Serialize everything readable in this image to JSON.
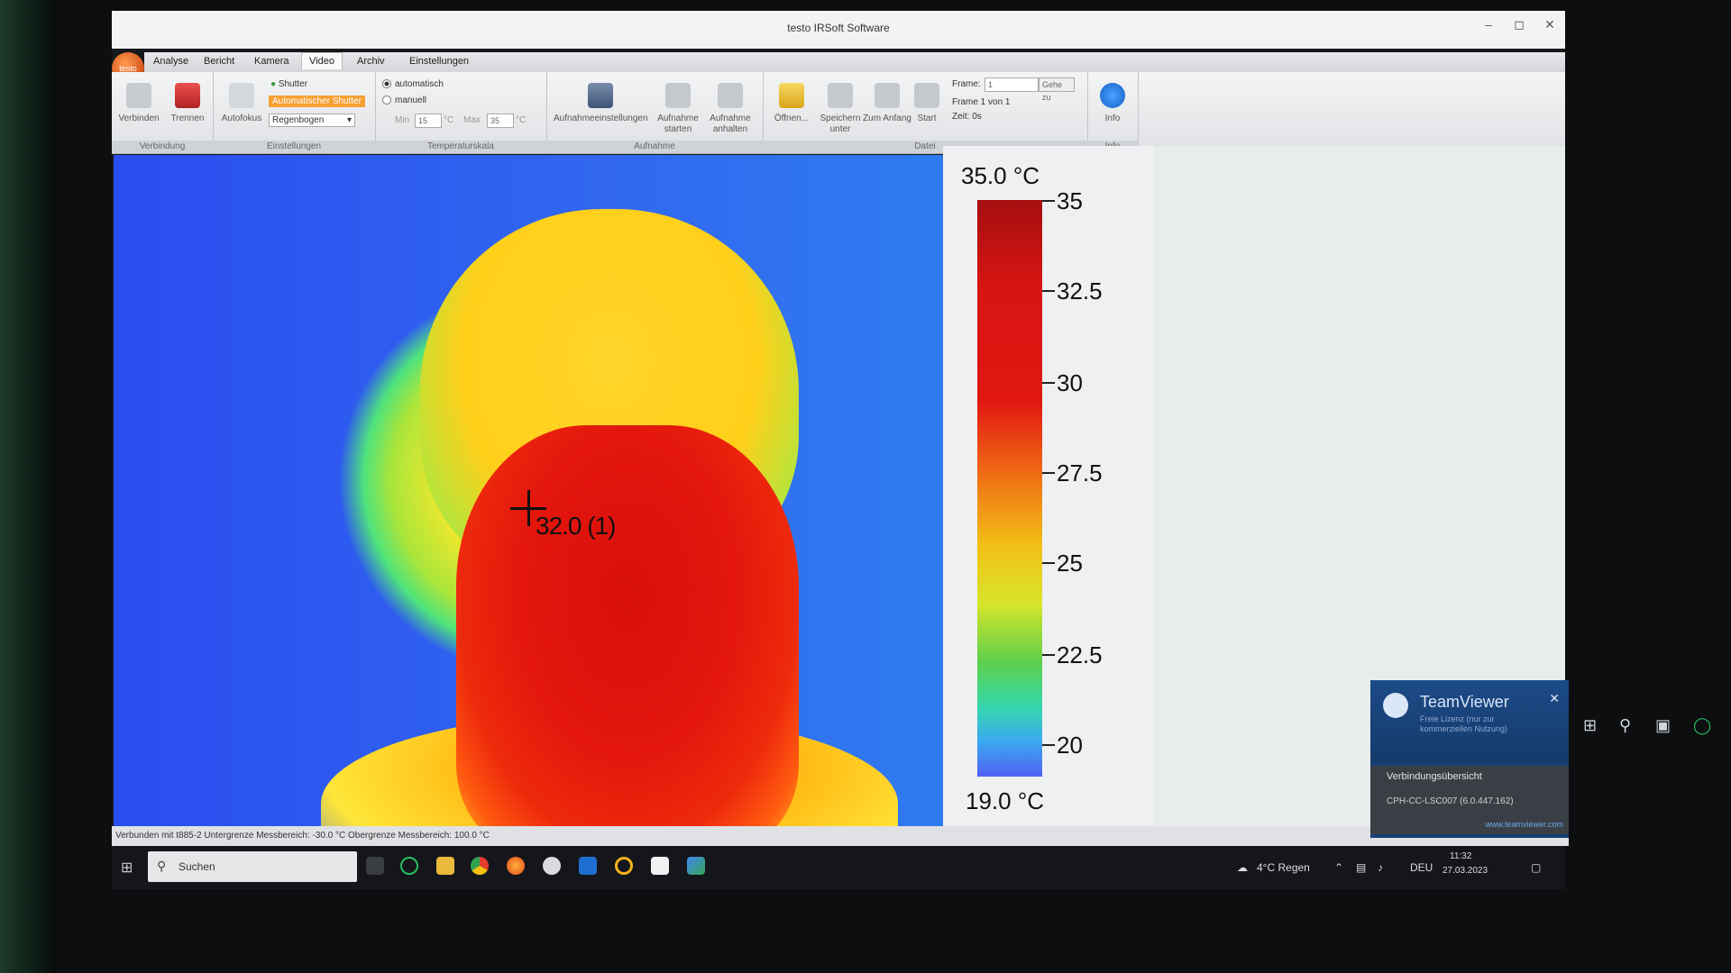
{
  "window": {
    "title": "testo IRSoft Software",
    "minimize": "–",
    "maximize": "◻",
    "close": "✕"
  },
  "logo": "testo",
  "menu": {
    "tabs": [
      "Analyse",
      "Bericht",
      "Kamera",
      "Video",
      "Archiv",
      "Einstellungen"
    ],
    "active": "Video"
  },
  "ribbon": {
    "verbindung": {
      "label": "Verbindung",
      "verbinden": "Verbinden",
      "trennen": "Trennen"
    },
    "einstellungen": {
      "label": "Einstellungen",
      "autofokus": "Autofokus",
      "shutter": "Shutter",
      "auto_shutter": "Automatischer Shutter",
      "palette": "Regenbogen"
    },
    "temperaturskala": {
      "label": "Temperaturskala",
      "automatisch": "automatisch",
      "manuell": "manuell",
      "min_label": "Min",
      "min_value": "15",
      "unit": "°C",
      "max_label": "Max",
      "max_value": "35"
    },
    "aufnahme": {
      "label": "Aufnahme",
      "einstellungen": "Aufnahmeeinstellungen",
      "starten": "Aufnahme starten",
      "anhalten": "Aufnahme anhalten"
    },
    "datei": {
      "label": "Datei",
      "oeffnen": "Öffnen...",
      "speichern": "Speichern unter",
      "zum_anfang": "Zum Anfang",
      "start": "Start",
      "frame_label": "Frame:",
      "frame_value": "1",
      "gehe_zu": "Gehe zu",
      "frame_info": "Frame 1 von 1",
      "zeit": "Zeit: 0s"
    },
    "info": {
      "label": "Info",
      "button": "Info"
    }
  },
  "thermal": {
    "measurement": "32.0 (1)"
  },
  "scale": {
    "max": "35.0 °C",
    "min": "19.0 °C",
    "ticks": [
      "35",
      "32.5",
      "30",
      "27.5",
      "25",
      "22.5",
      "20"
    ]
  },
  "status": "Verbunden mit t885-2   Untergrenze Messbereich: -30.0 °C  Obergrenze Messbereich: 100.0 °C",
  "taskbar": {
    "search": "Suchen",
    "weather": "4°C Regen",
    "lang": "DEU",
    "time": "11:32",
    "date": "27.03.2023"
  },
  "teamviewer": {
    "brand": "TeamViewer",
    "subtitle": "Freie Lizenz (nur zur kommerziellen Nutzung)",
    "section": "Verbindungsübersicht",
    "connection": "CPH-CC-LSC007 (6.0.447.162)",
    "link": "www.teamviewer.com"
  },
  "colors": {
    "accent": "#f28a1f",
    "scale_top": "#a50e10",
    "scale_bottom": "#5060f5"
  }
}
